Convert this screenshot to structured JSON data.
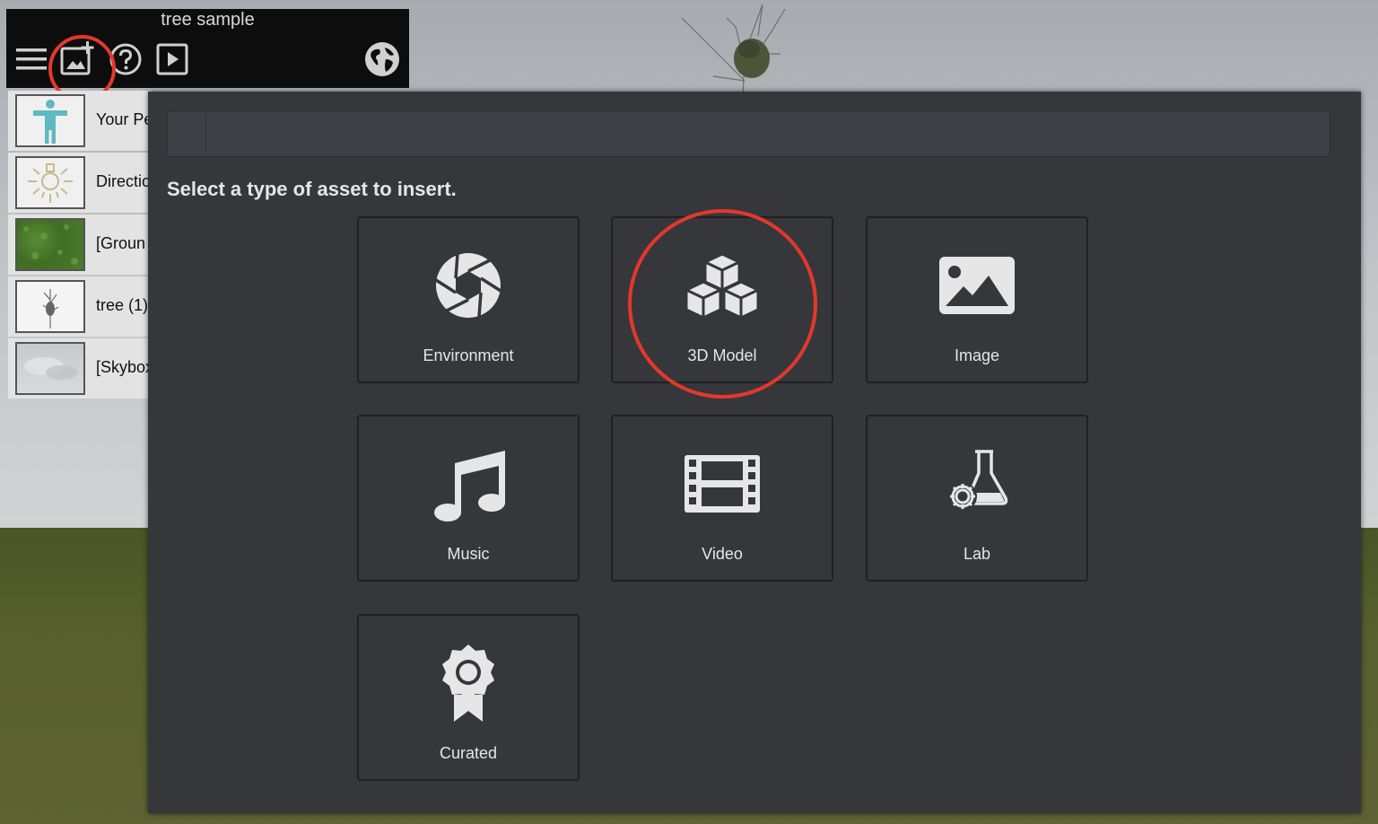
{
  "toolbar": {
    "title": "tree sample",
    "buttons": [
      {
        "icon": "hamburger-menu-icon"
      },
      {
        "icon": "insert-asset-icon"
      },
      {
        "icon": "help-icon"
      },
      {
        "icon": "play-icon"
      },
      {
        "icon": "globe-icon"
      }
    ]
  },
  "hierarchy": {
    "items": [
      {
        "label": "Your Pe",
        "icon": "person-icon"
      },
      {
        "label": "Directio",
        "icon": "light-bulb-icon"
      },
      {
        "label": "[Groun",
        "icon": "grass-texture-icon"
      },
      {
        "label": "tree (1)",
        "icon": "tree-icon"
      },
      {
        "label": "[Skybox",
        "icon": "skybox-icon"
      }
    ]
  },
  "dialog": {
    "search_value": "",
    "prompt": "Select a type of asset to insert.",
    "tiles": [
      {
        "label": "Environment",
        "icon": "camera-aperture-icon"
      },
      {
        "label": "3D Model",
        "icon": "cubes-icon"
      },
      {
        "label": "Image",
        "icon": "image-icon"
      },
      {
        "label": "Music",
        "icon": "music-note-icon"
      },
      {
        "label": "Video",
        "icon": "film-strip-icon"
      },
      {
        "label": "Lab",
        "icon": "lab-flask-gear-icon"
      },
      {
        "label": "Curated",
        "icon": "award-ribbon-icon"
      }
    ]
  },
  "colors": {
    "annotation": "#e2382b",
    "dialog_bg": "#35373b",
    "toolbar_bg": "#0d0d0d",
    "person_icon": "#5fb9c2"
  }
}
